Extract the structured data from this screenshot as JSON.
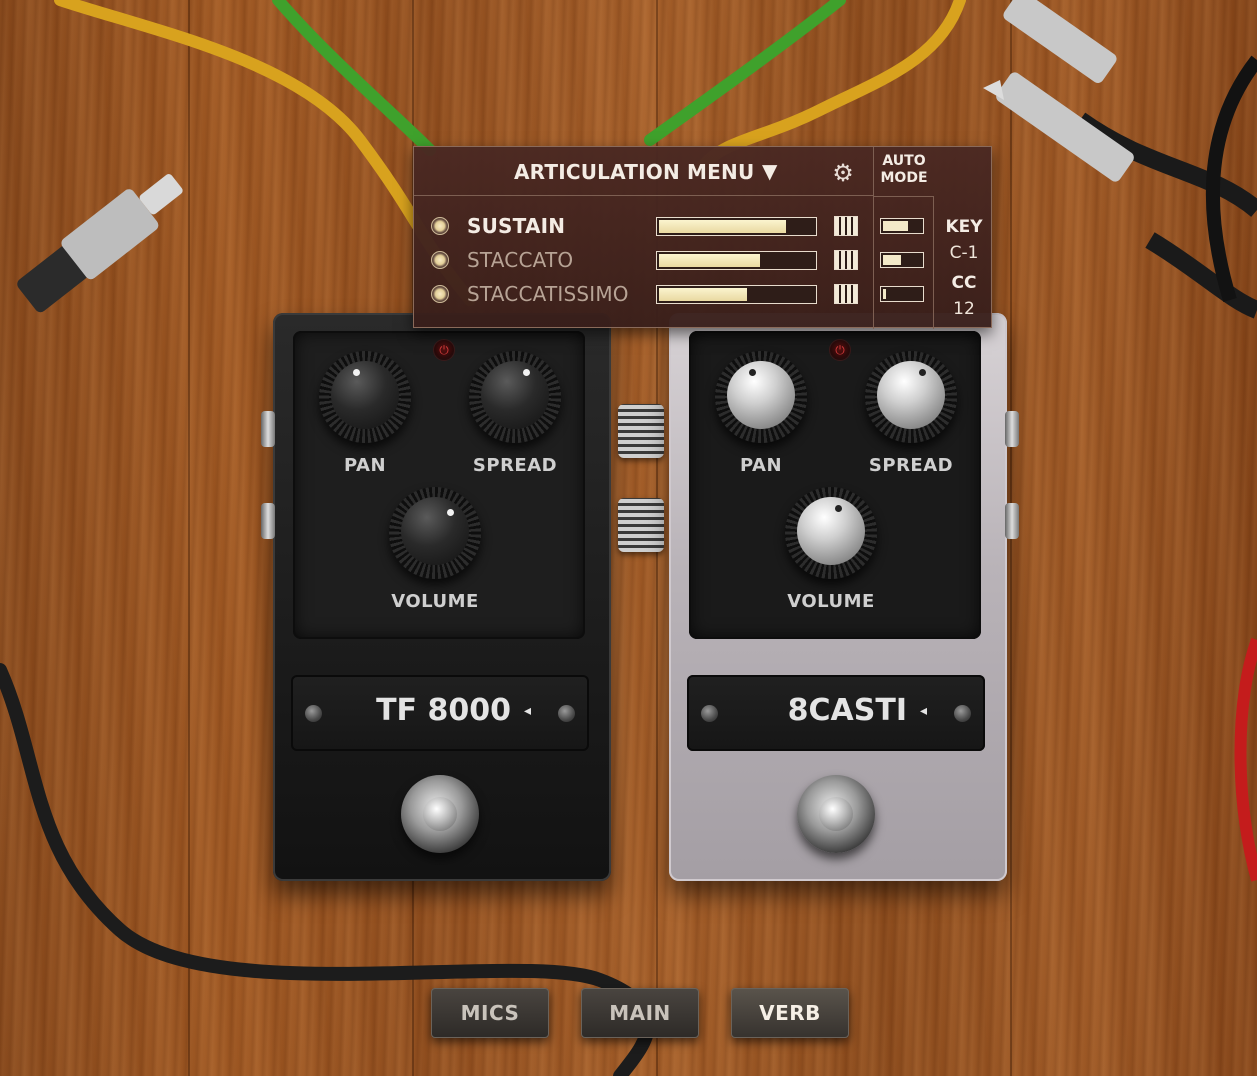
{
  "articulation_menu": {
    "title": "ARTICULATION MENU",
    "caret": "▼",
    "settings_icon": "gears-icon",
    "auto_mode_line1": "AUTO",
    "auto_mode_line2": "MODE",
    "items": [
      {
        "label": "SUSTAIN",
        "selected": true,
        "level": 0.82,
        "auto_level": 0.62
      },
      {
        "label": "STACCATO",
        "selected": false,
        "level": 0.65,
        "auto_level": 0.45
      },
      {
        "label": "STACCATISSIMO",
        "selected": false,
        "level": 0.57,
        "auto_level": 0.08
      }
    ],
    "key_title": "KEY",
    "key_value": "C-1",
    "cc_title": "CC",
    "cc_value": "12"
  },
  "pedals": [
    {
      "name": "TF 8000",
      "finish": "dark",
      "knob_labels": {
        "pan": "PAN",
        "spread": "SPREAD",
        "volume": "VOLUME"
      },
      "power_icon": "power-icon"
    },
    {
      "name": "8CASTI",
      "finish": "silver",
      "knob_labels": {
        "pan": "PAN",
        "spread": "SPREAD",
        "volume": "VOLUME"
      },
      "power_icon": "power-icon"
    }
  ],
  "nav_tabs": [
    {
      "label": "MICS",
      "active": false
    },
    {
      "label": "MAIN",
      "active": false
    },
    {
      "label": "VERB",
      "active": true
    }
  ],
  "colors": {
    "wood": "#9a5523",
    "menu_bg": "#4a2822",
    "menu_text": "#f4ece4",
    "fill": "#fbf4cf"
  }
}
